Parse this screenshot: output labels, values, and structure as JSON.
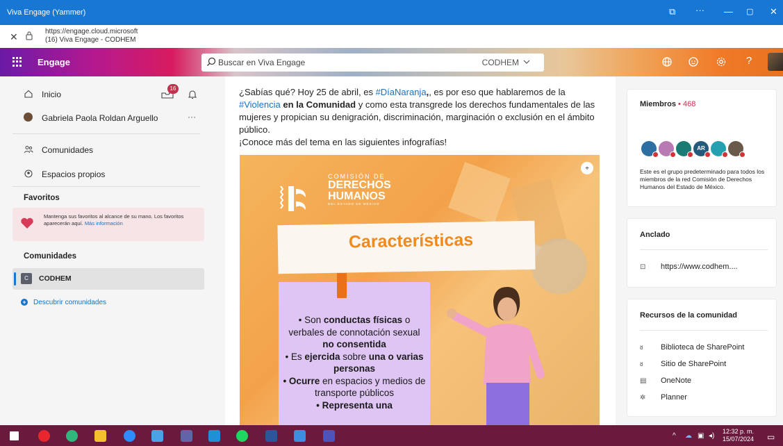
{
  "window": {
    "title": "Viva Engage (Yammer)",
    "controls": [
      "⧉",
      "···",
      "—",
      "▢",
      "✕"
    ]
  },
  "address": {
    "url": "https://engage.cloud.microsoft",
    "page_title": "(16) Viva Engage - CODHEM"
  },
  "appbar": {
    "app_name": "Engage",
    "search_placeholder": "Buscar en Viva Engage",
    "search_scope": "CODHEM",
    "icons": [
      "globe-icon",
      "smiley-icon",
      "settings-icon",
      "help-icon"
    ],
    "help_label": "?"
  },
  "sidebar": {
    "home_label": "Inicio",
    "inbox_badge": "16",
    "user_name": "Gabriela Paola Roldan Arguello",
    "more_label": "···",
    "communities_label": "Comunidades",
    "storylines_label": "Espacios propios",
    "favorites_heading": "Favoritos",
    "favorites_text": "Mantenga sus favoritos al alcance de su mano. Los favoritos aparecerán aquí.",
    "favorites_link": "Más información",
    "communities_heading": "Comunidades",
    "community_logo": "C",
    "community_name": "CODHEM",
    "discover_label": "Descubrir comunidades"
  },
  "post": {
    "p1": "¿Sabías qué? Hoy 25 de abril, es ",
    "tag1": "#DíaNaranja",
    "p2": ", es por eso que hablaremos de la ",
    "tag2": "#Violencia",
    "p3": " en la Comunidad",
    "p4": " y como esta transgrede los derechos fundamentales de las mujeres y propician su denigración, discriminación, marginación o exclusión en el ámbito público.",
    "p5": "¡Conoce más del tema en las siguientes infografías!",
    "infographic": {
      "org_line1": "COMISIÓN DE",
      "org_line2": "DERECHOS",
      "org_line3": "HUMANOS",
      "org_line4": "DEL ESTADO DE MÉXICO",
      "title": "Características",
      "b1a": "• Son ",
      "b1b": "conductas físicas",
      "b1c": " o verbales de connotación sexual ",
      "b1d": "no consentida",
      "b2a": "• Es ",
      "b2b": "ejercida",
      "b2c": " sobre ",
      "b2d": "una o varias personas",
      "b3a": "• Ocurre",
      "b3b": " en espacios y medios de transporte públicos",
      "b4": "• Representa una"
    }
  },
  "members": {
    "heading": "Miembros",
    "sep": "•",
    "count": "468",
    "avatars": [
      {
        "initials": "",
        "color": "#2d6ea3"
      },
      {
        "initials": "",
        "color": "#b77ab3"
      },
      {
        "initials": "",
        "color": "#1a7a74"
      },
      {
        "initials": "AR",
        "color": "#245b7a"
      },
      {
        "initials": "",
        "color": "#24a0b0"
      },
      {
        "initials": "",
        "color": "#6a5a4c"
      }
    ],
    "description": "Este es el grupo predeterminado para todos los miembros de la red Comisión de Derechos Humanos del Estado de México."
  },
  "pinned": {
    "heading": "Anclado",
    "link": "https://www.codhem...."
  },
  "resources": {
    "heading": "Recursos de la comunidad",
    "items": [
      "Biblioteca de SharePoint",
      "Sitio de SharePoint",
      "OneNote",
      "Planner"
    ]
  },
  "taskbar": {
    "time": "12:32 p. m.",
    "date": "15/07/2024",
    "apps": [
      {
        "name": "start",
        "color": "#ffffff"
      },
      {
        "name": "opera",
        "color": "#e8262e"
      },
      {
        "name": "edge",
        "color": "#2fb67c"
      },
      {
        "name": "explorer",
        "color": "#f3c12d"
      },
      {
        "name": "zoom",
        "color": "#2d8cff"
      },
      {
        "name": "photos",
        "color": "#4aa3e8"
      },
      {
        "name": "teams",
        "color": "#6264a7"
      },
      {
        "name": "store",
        "color": "#1e90d6"
      },
      {
        "name": "spotify",
        "color": "#1ed760"
      },
      {
        "name": "word",
        "color": "#2b579a"
      },
      {
        "name": "gallery",
        "color": "#3d8ee0"
      },
      {
        "name": "teams-work",
        "color": "#4b53bc"
      }
    ]
  }
}
